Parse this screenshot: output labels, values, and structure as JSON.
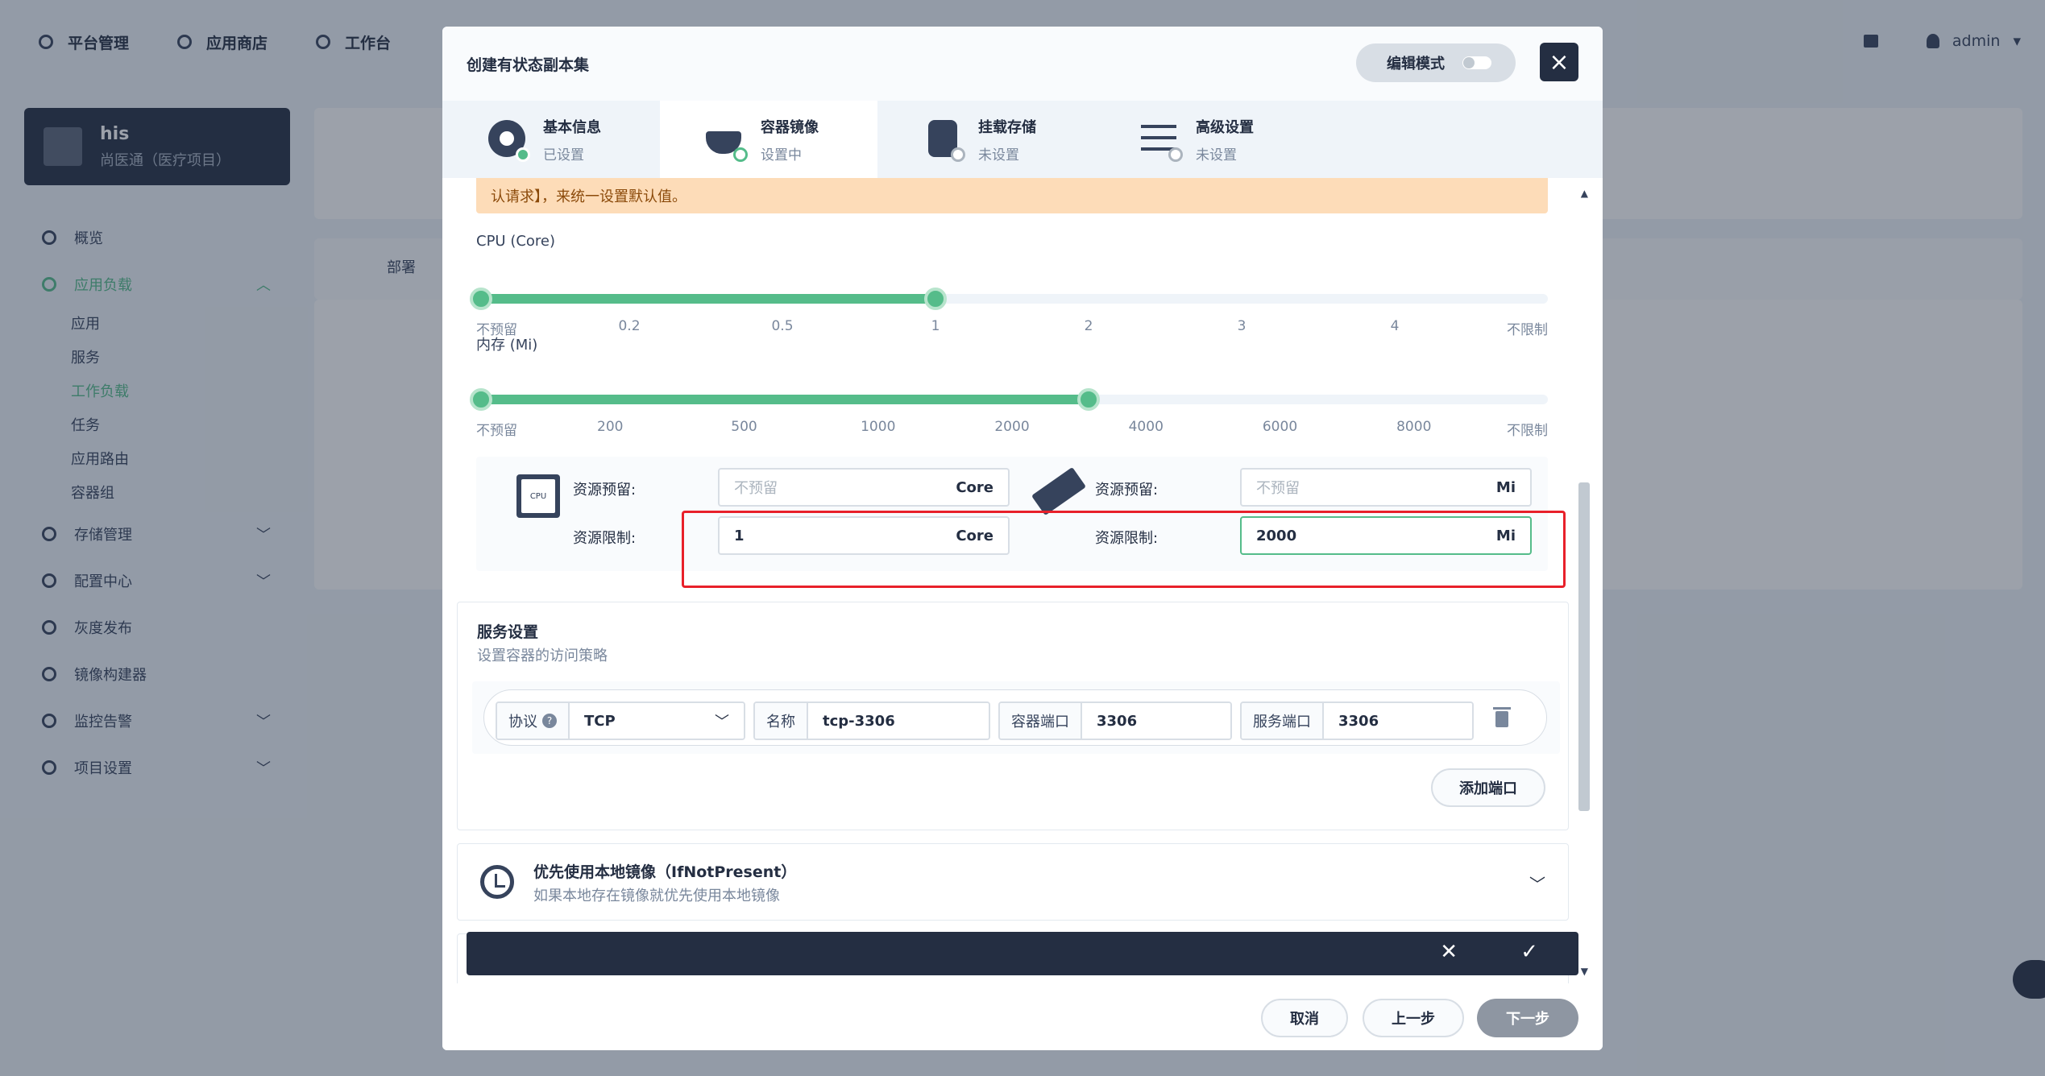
{
  "topbar": {
    "nav": [
      {
        "label": "平台管理",
        "icon": "gear-icon"
      },
      {
        "label": "应用商店",
        "icon": "store-icon"
      },
      {
        "label": "工作台",
        "icon": "workbench-icon"
      }
    ],
    "user": "admin"
  },
  "project": {
    "name": "his",
    "description": "尚医通（医疗项目）"
  },
  "sidebar": {
    "items": [
      {
        "label": "概览",
        "icon": "overview-icon"
      },
      {
        "label": "应用负载",
        "icon": "workload-icon",
        "expanded": true
      },
      {
        "label": "存储管理",
        "icon": "storage-icon"
      },
      {
        "label": "配置中心",
        "icon": "config-icon"
      },
      {
        "label": "灰度发布",
        "icon": "grayscale-icon"
      },
      {
        "label": "镜像构建器",
        "icon": "image-builder-icon"
      },
      {
        "label": "监控告警",
        "icon": "monitor-icon"
      },
      {
        "label": "项目设置",
        "icon": "project-settings-icon"
      }
    ],
    "sub_items": [
      "应用",
      "服务",
      "工作负载",
      "任务",
      "应用路由",
      "容器组"
    ],
    "active_sub": "工作负载"
  },
  "background": {
    "deploy_tab": "部署"
  },
  "modal": {
    "title": "创建有状态副本集",
    "edit_mode_label": "编辑模式",
    "close_label": "×",
    "steps": [
      {
        "title": "基本信息",
        "status": "已设置"
      },
      {
        "title": "容器镜像",
        "status": "设置中"
      },
      {
        "title": "挂载存储",
        "status": "未设置"
      },
      {
        "title": "高级设置",
        "status": "未设置"
      }
    ],
    "warning_text": "认请求】，来统一设置默认值。",
    "cpu_slider": {
      "label": "CPU (Core)",
      "ticks": [
        "不预留",
        "0.2",
        "0.5",
        "1",
        "2",
        "3",
        "4",
        "不限制"
      ],
      "reserve_value": "不预留",
      "limit_value": "1",
      "fill_fraction": 0.4286
    },
    "memory_slider": {
      "label": "内存 (Mi)",
      "ticks": [
        "不预留",
        "200",
        "500",
        "1000",
        "2000",
        "4000",
        "6000",
        "8000",
        "不限制"
      ],
      "reserve_value": "不预留",
      "limit_value": "2000",
      "fill_fraction": 0.5714
    },
    "resources": {
      "cpu": {
        "chip_text": "CPU",
        "reserve_label": "资源预留:",
        "reserve_placeholder": "不预留",
        "limit_label": "资源限制:",
        "limit_value": "1",
        "unit": "Core"
      },
      "memory": {
        "reserve_label": "资源预留:",
        "reserve_placeholder": "不预留",
        "limit_label": "资源限制:",
        "limit_value": "2000",
        "unit": "Mi"
      }
    },
    "service": {
      "title": "服务设置",
      "subtitle": "设置容器的访问策略",
      "protocol_label": "协议",
      "protocol_value": "TCP",
      "name_label": "名称",
      "name_value": "tcp-3306",
      "container_port_label": "容器端口",
      "container_port_value": "3306",
      "service_port_label": "服务端口",
      "service_port_value": "3306",
      "add_port_label": "添加端口"
    },
    "pull_policy": {
      "title": "优先使用本地镜像（IfNotPresent）",
      "subtitle": "如果本地存在镜像就优先使用本地镜像"
    },
    "footer": {
      "cancel": "取消",
      "previous": "上一步",
      "next": "下一步"
    }
  }
}
